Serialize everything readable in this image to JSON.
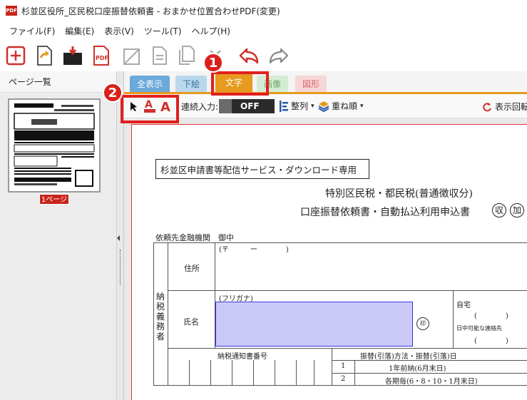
{
  "window": {
    "app_icon_text": "PDF",
    "title": "杉並区役所_区民税口座振替依頼書 - おまかせ位置合わせPDF(変更)"
  },
  "menu": [
    "ファイル(F)",
    "編集(E)",
    "表示(V)",
    "ツール(T)",
    "ヘルプ(H)"
  ],
  "toolbar": {
    "icons": [
      "add-icon",
      "export-icon",
      "folder-icon",
      "pdf-icon",
      "crop-icon",
      "page-icon",
      "copy-page-icon",
      "delete-icon",
      "undo-icon",
      "redo-icon"
    ],
    "pdf_label": "PDF"
  },
  "left_panel": {
    "header": "ページ一覧",
    "page_label": "1ページ"
  },
  "tabs": [
    {
      "label": "全表示",
      "bg": "#6aa9d9",
      "color": "#ffffff"
    },
    {
      "label": "下絵",
      "bg": "#b9d8ee",
      "color": "#3a6f99"
    },
    {
      "label": "文字",
      "bg": "#e69a1e",
      "color": "#ffffff"
    },
    {
      "label": "画像",
      "bg": "#d4ecd4",
      "color": "#66aa66"
    },
    {
      "label": "図形",
      "bg": "#f6d6d6",
      "color": "#dd6666"
    }
  ],
  "subtoolbar": {
    "continuous_input_label": "連続入力:",
    "toggle_value": "OFF",
    "align_label": "整列",
    "order_label": "重ね順",
    "rotate_label": "表示回転"
  },
  "callouts": {
    "one": "1",
    "two": "2"
  },
  "document": {
    "header_box": "杉並区申請書等配信サービス・ダウンロード専用",
    "title1": "特別区民税・都民税(普通徴収分)",
    "title2": "口座振替依頼書・自動払込利用申込書",
    "title2_circle1": "収",
    "title2_circle2": "加",
    "bank_to": "依頼先金融機関　御中",
    "postal_prefix": "(〒　　　ー　　　　)",
    "address_label": "住所",
    "furigana_label": "(フリガナ)",
    "name_label": "氏名",
    "seal_label": "印",
    "home_label": "自宅",
    "home_paren": "(　　　　)",
    "daytime_label": "日中可能な連絡先",
    "daytime_paren": "(　　　　)",
    "taxpayer_label": "納税義務者",
    "notice_number_label": "納税通知書番号",
    "transfer_label": "振替(引落)方法・振替(引落)日",
    "options": [
      {
        "no": "1",
        "text": "1年前納(6月末日)"
      },
      {
        "no": "2",
        "text": "各期毎(6・8・10・1月末日)"
      }
    ]
  },
  "colors": {
    "accent_orange": "#e69a1e",
    "highlight_red": "#e0201e",
    "name_field_fill": "#cbcaf7",
    "name_field_border": "#3a35d8"
  }
}
